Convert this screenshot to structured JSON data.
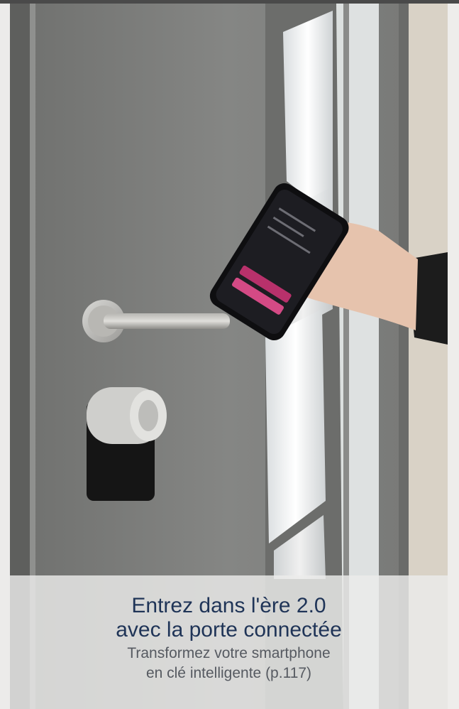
{
  "caption": {
    "headline_line1": "Entrez dans l'ère 2.0",
    "headline_line2": "avec la porte connectée",
    "subline_line1": "Transformez votre smartphone",
    "subline_line2": "en clé intelligente (p.117)"
  },
  "colors": {
    "headline": "#1f3457",
    "subline": "#565a61",
    "door": "#7c7d7b",
    "caption_band": "#ecece9"
  }
}
